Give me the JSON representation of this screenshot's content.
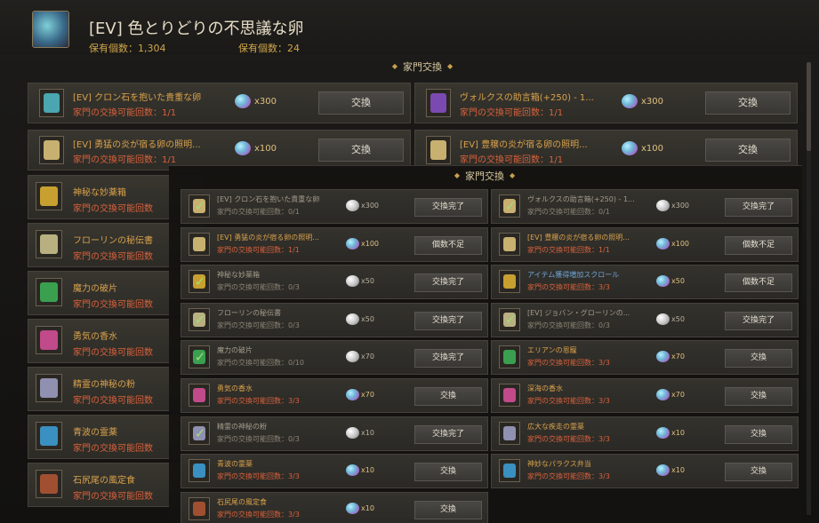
{
  "header": {
    "title": "[EV] 色とりどりの不思議な卵",
    "count1": "保有個数：1,304",
    "count2": "保有個数：24"
  },
  "section_title": "家門交換",
  "overlay_title": "家門交換",
  "big_items": [
    {
      "name": "[EV] クロン石を抱いた貴重な卵",
      "count": "家門の交換可能回数：1/1",
      "qty": "x300",
      "btn": "交換"
    },
    {
      "name": "ヴォルクスの助言箱(+250) - 1...",
      "count": "家門の交換可能回数：1/1",
      "qty": "x300",
      "btn": "交換"
    },
    {
      "name": "[EV] 勇猛の炎が宿る卵の照明...",
      "count": "家門の交換可能回数：1/1",
      "qty": "x100",
      "btn": "交換"
    },
    {
      "name": "[EV] 豊穣の炎が宿る卵の照明...",
      "count": "家門の交換可能回数：1/1",
      "qty": "x100",
      "btn": "交換"
    }
  ],
  "side_items": [
    {
      "name": "神秘な妙薬箱",
      "count": "家門の交換可能回数"
    },
    {
      "name": "フローリンの秘伝書",
      "count": "家門の交換可能回数"
    },
    {
      "name": "魔力の破片",
      "count": "家門の交換可能回数"
    },
    {
      "name": "勇気の香水",
      "count": "家門の交換可能回数"
    },
    {
      "name": "精霊の神秘の粉",
      "count": "家門の交換可能回数"
    },
    {
      "name": "青波の霊薬",
      "count": "家門の交換可能回数"
    },
    {
      "name": "石尻尾の風定食",
      "count": "家門の交換可能回数"
    }
  ],
  "small_left": [
    {
      "name": "[EV] クロン石を抱いた貴重な卵",
      "count": "家門の交換可能回数：0/1",
      "qty": "x300",
      "btn": "交換完了",
      "state": "done"
    },
    {
      "name": "[EV] 勇猛の炎が宿る卵の照明...",
      "count": "家門の交換可能回数：1/1",
      "qty": "x100",
      "btn": "個数不足",
      "state": "avail"
    },
    {
      "name": "神秘な妙薬箱",
      "count": "家門の交換可能回数：0/3",
      "qty": "x50",
      "btn": "交換完了",
      "state": "done"
    },
    {
      "name": "フローリンの秘伝書",
      "count": "家門の交換可能回数：0/3",
      "qty": "x50",
      "btn": "交換完了",
      "state": "done"
    },
    {
      "name": "魔力の破片",
      "count": "家門の交換可能回数：0/10",
      "qty": "x70",
      "btn": "交換完了",
      "state": "done"
    },
    {
      "name": "勇気の香水",
      "count": "家門の交換可能回数：3/3",
      "qty": "x70",
      "btn": "交換",
      "state": "avail"
    },
    {
      "name": "精霊の神秘の粉",
      "count": "家門の交換可能回数：0/3",
      "qty": "x10",
      "btn": "交換完了",
      "state": "done"
    },
    {
      "name": "青波の霊薬",
      "count": "家門の交換可能回数：3/3",
      "qty": "x10",
      "btn": "交換",
      "state": "avail"
    },
    {
      "name": "石尻尾の風定食",
      "count": "家門の交換可能回数：3/3",
      "qty": "x10",
      "btn": "交換",
      "state": "avail"
    }
  ],
  "small_right": [
    {
      "name": "ヴォルクスの助言箱(+250) - 1...",
      "count": "家門の交換可能回数：0/1",
      "qty": "x300",
      "btn": "交換完了",
      "state": "done"
    },
    {
      "name": "[EV] 豊穣の炎が宿る卵の照明...",
      "count": "家門の交換可能回数：1/1",
      "qty": "x100",
      "btn": "個数不足",
      "state": "avail"
    },
    {
      "name": "アイテム獲得増加スクロール",
      "count": "家門の交換可能回数：3/3",
      "qty": "x50",
      "btn": "個数不足",
      "state": "blue"
    },
    {
      "name": "[EV] ジョバン・グローリンの...",
      "count": "家門の交換可能回数：0/3",
      "qty": "x50",
      "btn": "交換完了",
      "state": "done"
    },
    {
      "name": "エリアンの恩寵",
      "count": "家門の交換可能回数：3/3",
      "qty": "x70",
      "btn": "交換",
      "state": "avail"
    },
    {
      "name": "深海の香水",
      "count": "家門の交換可能回数：3/3",
      "qty": "x70",
      "btn": "交換",
      "state": "avail"
    },
    {
      "name": "広大な疾走の霊薬",
      "count": "家門の交換可能回数：3/3",
      "qty": "x10",
      "btn": "交換",
      "state": "avail"
    },
    {
      "name": "神妙なパラクス弁当",
      "count": "家門の交換可能回数：3/3",
      "qty": "x10",
      "btn": "交換",
      "state": "avail"
    }
  ]
}
